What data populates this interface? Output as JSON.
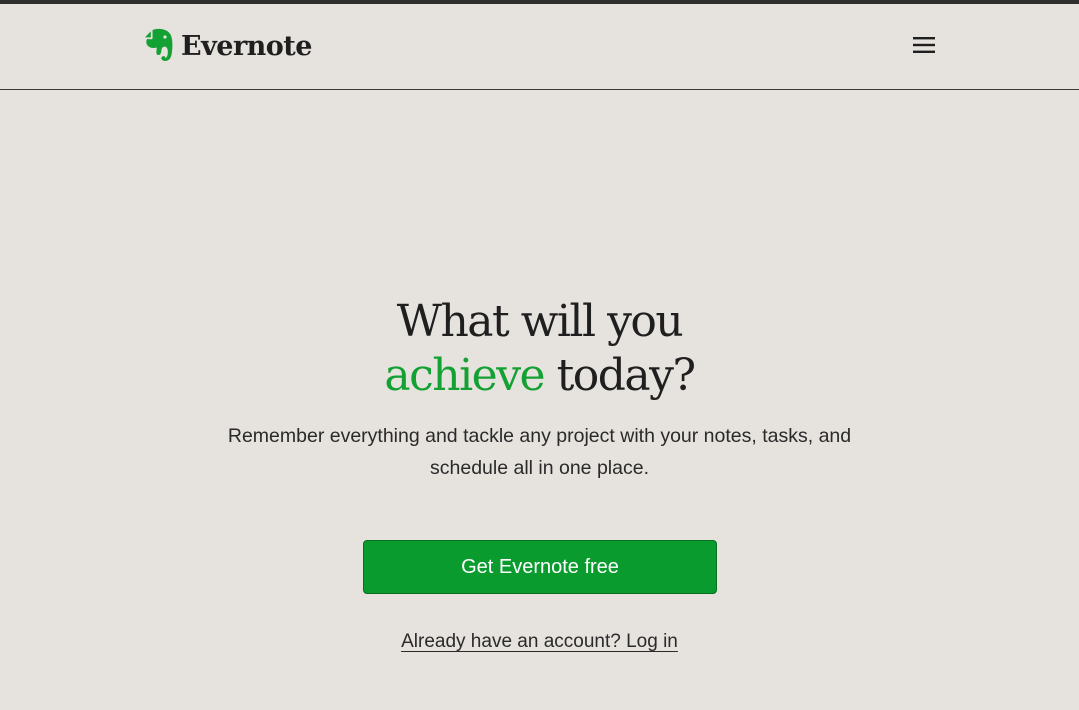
{
  "brand": {
    "name": "Evernote",
    "accent_color": "#14a133",
    "icon": "elephant-logo-icon"
  },
  "header": {
    "menu_icon": "hamburger-menu-icon"
  },
  "hero": {
    "headline_line1": "What will you",
    "headline_accent": "achieve",
    "headline_rest": " today?",
    "subtext": "Remember everything and tackle any project with your notes, tasks, and schedule all in one place."
  },
  "cta": {
    "label": "Get Evernote free",
    "color": "#0a9b2e"
  },
  "login": {
    "label": "Already have an account? Log in"
  },
  "colors": {
    "background": "#e6e2de",
    "text": "#1f1f1f"
  }
}
